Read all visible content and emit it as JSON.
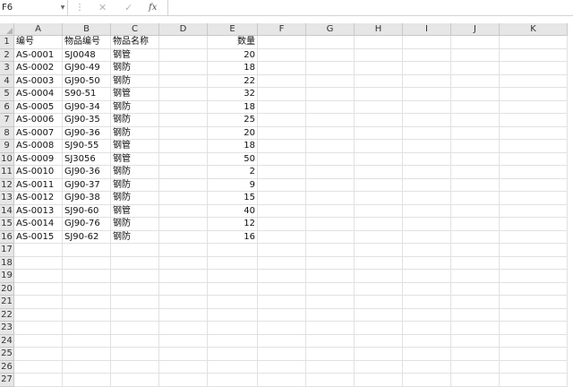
{
  "formula_bar": {
    "name_box": "F6",
    "cancel_glyph": "✕",
    "enter_glyph": "✓",
    "fx_label": "fx",
    "formula": ""
  },
  "columns": [
    "A",
    "B",
    "C",
    "D",
    "E",
    "F",
    "G",
    "H",
    "I",
    "J",
    "K"
  ],
  "rows": [
    "1",
    "2",
    "3",
    "4",
    "5",
    "6",
    "7",
    "8",
    "9",
    "10",
    "11",
    "12",
    "13",
    "14",
    "15",
    "16",
    "17",
    "18",
    "19",
    "20",
    "21",
    "22",
    "23",
    "24",
    "25",
    "26",
    "27"
  ],
  "sheet": {
    "headers": [
      "编号",
      "物品编号",
      "物品名称",
      "",
      "数量"
    ],
    "records": [
      [
        "AS-0001",
        "SJ0048",
        "钢管",
        "",
        "20"
      ],
      [
        "AS-0002",
        "GJ90-49",
        "钢防",
        "",
        "18"
      ],
      [
        "AS-0003",
        "GJ90-50",
        "钢防",
        "",
        "22"
      ],
      [
        "AS-0004",
        "S90-51",
        "钢管",
        "",
        "32"
      ],
      [
        "AS-0005",
        "GJ90-34",
        "钢防",
        "",
        "18"
      ],
      [
        "AS-0006",
        "GJ90-35",
        "钢防",
        "",
        "25"
      ],
      [
        "AS-0007",
        "GJ90-36",
        "钢防",
        "",
        "20"
      ],
      [
        "AS-0008",
        "SJ90-55",
        "钢管",
        "",
        "18"
      ],
      [
        "AS-0009",
        "SJ3056",
        "钢管",
        "",
        "50"
      ],
      [
        "AS-0010",
        "GJ90-36",
        "钢防",
        "",
        "2"
      ],
      [
        "AS-0011",
        "GJ90-37",
        "钢防",
        "",
        "9"
      ],
      [
        "AS-0012",
        "GJ90-38",
        "钢防",
        "",
        "15"
      ],
      [
        "AS-0013",
        "SJ90-60",
        "钢管",
        "",
        "40"
      ],
      [
        "AS-0014",
        "GJ90-76",
        "钢防",
        "",
        "12"
      ],
      [
        "AS-0015",
        "SJ90-62",
        "钢防",
        "",
        "16"
      ]
    ]
  }
}
